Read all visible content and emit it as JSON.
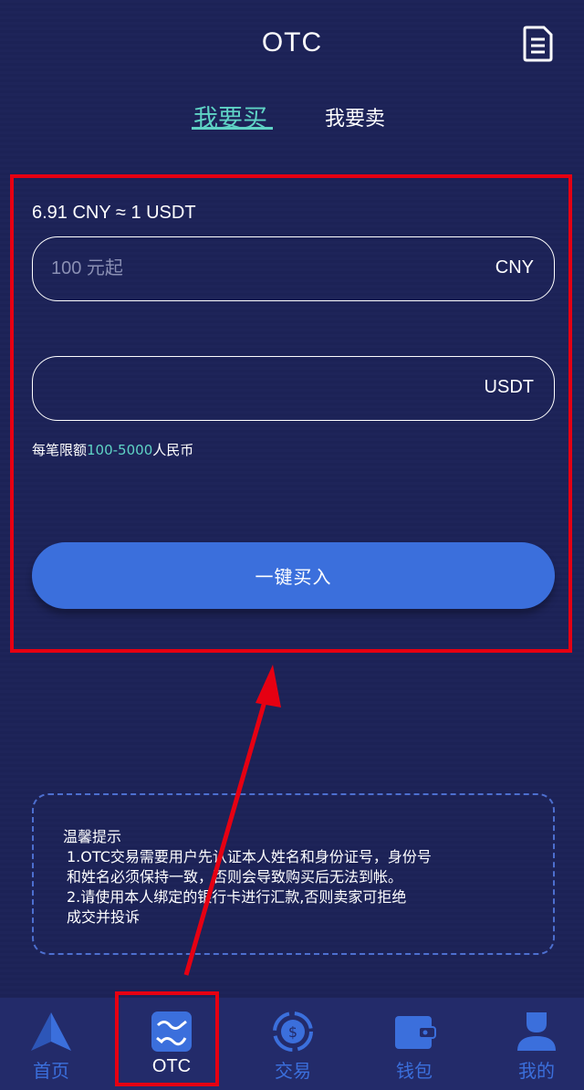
{
  "header": {
    "title": "OTC",
    "orders_icon": "document-list-icon"
  },
  "tabs": {
    "buy": "我要买",
    "sell": "我要卖",
    "active": "buy"
  },
  "trade": {
    "rate": "6.91 CNY ≈ 1 USDT",
    "cny_placeholder": "100 元起",
    "cny_value": "",
    "cny_unit": "CNY",
    "usdt_placeholder": "",
    "usdt_value": "",
    "usdt_unit": "USDT",
    "limit_prefix": "每笔限额",
    "limit_range": "100-5000",
    "limit_suffix": "人民币",
    "buy_button": "一键买入"
  },
  "tips": {
    "title": "温馨提示",
    "lines": [
      "1.OTC交易需要用户先认证本人姓名和身份证号，身份号",
      "和姓名必须保持一致，否则会导致购买后无法到帐。",
      "2.请使用本人绑定的银行卡进行汇款,否则卖家可拒绝",
      "成交并投诉"
    ]
  },
  "bottom_nav": {
    "items": [
      {
        "label": "首页",
        "icon": "home-triangle-icon"
      },
      {
        "label": "OTC",
        "icon": "otc-exchange-icon",
        "active": true
      },
      {
        "label": "交易",
        "icon": "trade-dollar-icon"
      },
      {
        "label": "钱包",
        "icon": "wallet-icon"
      },
      {
        "label": "我的",
        "icon": "user-profile-icon"
      }
    ]
  },
  "colors": {
    "background": "#1e2459",
    "accent_teal": "#5fd3c5",
    "button_blue": "#3b6fdc",
    "annotation_red": "#e60012"
  }
}
